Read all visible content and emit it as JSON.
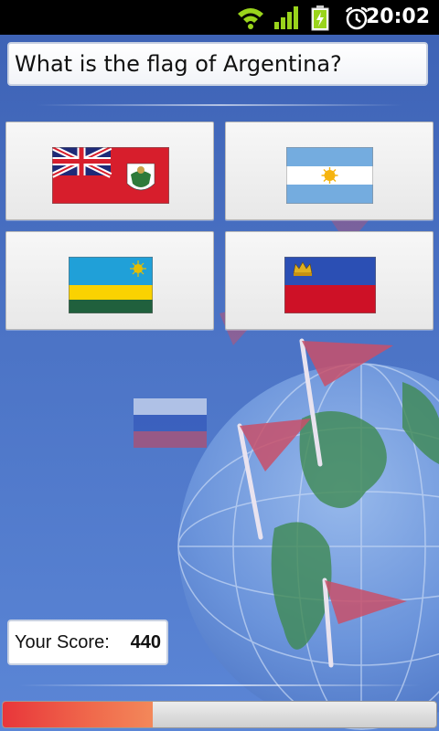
{
  "status_bar": {
    "time": "20:02",
    "icons": [
      "wifi-icon",
      "signal-icon",
      "battery-charging-icon",
      "alarm-icon"
    ]
  },
  "question": {
    "text": "What is the flag of Argentina?"
  },
  "answers": [
    {
      "flag": "Bermuda",
      "icon": "bermuda-flag-icon"
    },
    {
      "flag": "Argentina",
      "icon": "argentina-flag-icon"
    },
    {
      "flag": "Rwanda",
      "icon": "rwanda-flag-icon"
    },
    {
      "flag": "Liechtenstein",
      "icon": "liechtenstein-flag-icon"
    }
  ],
  "score": {
    "label": "Your Score:",
    "value": "440"
  },
  "progress": {
    "fraction": 0.345
  },
  "colors": {
    "background": "#3f63b3",
    "progress_fill": "#e8363a"
  }
}
